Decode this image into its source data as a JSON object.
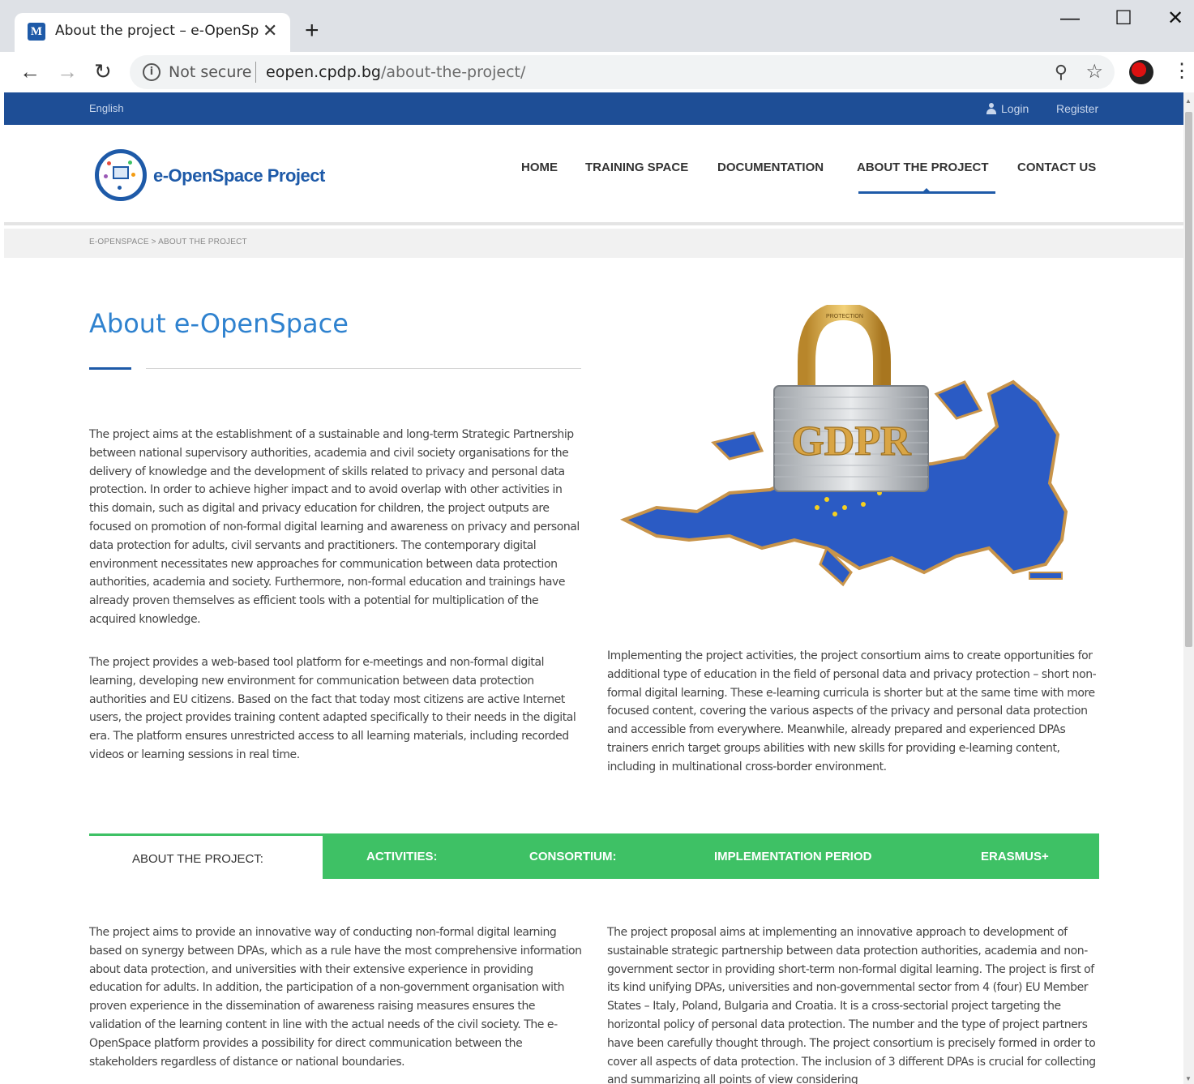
{
  "browser": {
    "tab_title": "About the project – e-OpenSpace",
    "tab_favicon": "M",
    "close_glyph": "✕",
    "new_tab_glyph": "+",
    "minimize_glyph": "—",
    "maximize_glyph": "☐",
    "window_close_glyph": "✕",
    "back_glyph": "←",
    "forward_glyph": "→",
    "reload_glyph": "↻",
    "info_glyph": "i",
    "security_label": "Not secure",
    "url_domain": "eopen.cpdp.bg",
    "url_path": "/about-the-project/",
    "zoom_glyph": "⚲",
    "star_glyph": "☆",
    "menu_glyph": "⋮"
  },
  "topbar": {
    "language": "English",
    "login": "Login",
    "register": "Register"
  },
  "header": {
    "logo_text": "e-OpenSpace Project",
    "nav": [
      "HOME",
      "TRAINING SPACE",
      "DOCUMENTATION",
      "ABOUT THE PROJECT",
      "CONTACT US"
    ],
    "active_nav": "ABOUT THE PROJECT"
  },
  "breadcrumb": "E-OPENSPACE > ABOUT THE PROJECT",
  "main": {
    "title": "About e-OpenSpace",
    "left_paragraphs": [
      "The project aims at the establishment of a sustainable and long-term Strategic Partnership between national supervisory authorities, academia and civil society organisations for the delivery of knowledge and the development of skills related to privacy and personal data protection. In order to achieve higher impact and to avoid overlap with other activities in this domain, such as digital and privacy education for children, the project outputs are focused on promotion of non-formal digital learning and awareness on privacy and personal data protection for adults, civil servants and practitioners. The contemporary digital environment necessitates new approaches for communication between data protection authorities, academia and society. Furthermore, non-formal education and trainings have already proven themselves as efficient tools with a potential for multiplication of the acquired knowledge.",
      "The project provides a web-based tool platform for e-meetings and non-formal digital learning, developing new environment for communication between data protection authorities and EU citizens. Based on the fact that today most citizens are active Internet users, the project provides training content adapted specifically to their needs in the digital era. The platform ensures unrestricted access to all learning materials, including recorded videos or learning sessions in real time."
    ],
    "image_text": "GDPR",
    "image_small_text": "PROTECTION",
    "right_paragraph": "Implementing the project activities, the project consortium aims to create opportunities for additional type of education in the field of personal data and privacy protection – short non-formal digital learning. These e-learning curricula is shorter but at the same time with more focused content, covering the various aspects of the privacy and personal data protection and accessible from everywhere. Meanwhile, already prepared and experienced DPAs trainers enrich target groups abilities with new skills for providing e-learning content, including in multinational cross-border environment."
  },
  "tabs": {
    "items": [
      "ABOUT THE PROJECT:",
      "ACTIVITIES:",
      "CONSORTIUM:",
      "IMPLEMENTATION PERIOD",
      "ERASMUS+"
    ],
    "active": "ABOUT THE PROJECT:"
  },
  "tab_content": {
    "left": "The project aims to provide an innovative way of conducting non-formal digital learning based on synergy between DPAs, which as a rule have the most comprehensive information about data protection, and universities with their extensive experience in providing education for adults. In addition, the participation of a non-government organisation with proven experience in the dissemination of awareness raising measures ensures the validation of the learning content in line with the actual needs of the civil society. The e-OpenSpace platform provides a possibility for direct communication between the stakeholders regardless of distance or national boundaries.",
    "right": "The project proposal aims at implementing an innovative approach to development of sustainable strategic partnership between data protection authorities, academia and non-government sector in providing short-term non-formal digital learning. The project is first of its kind unifying DPAs, universities and non-governmental sector from 4 (four) EU Member States – Italy, Poland, Bulgaria and Croatia. It is a cross-sectorial project targeting the horizontal policy of personal data protection.  The number and the type of project partners have been carefully thought through. The project consortium is precisely formed in order to cover all aspects of data protection. The inclusion of 3 different DPAs is crucial for collecting and summarizing all points of view considering"
  },
  "colors": {
    "brand_blue": "#1e4e96",
    "title_blue": "#2f82cf",
    "tab_green": "#3ec165"
  }
}
